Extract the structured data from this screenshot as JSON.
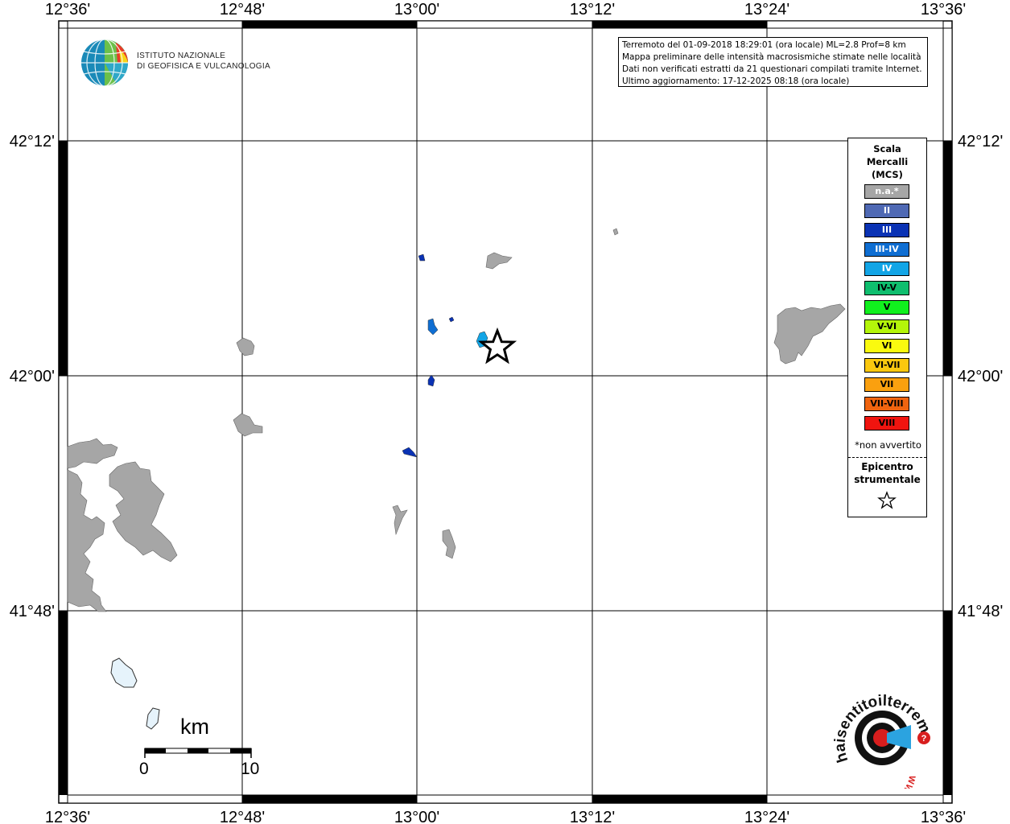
{
  "map": {
    "lon_ticks": [
      "12°36'",
      "12°48'",
      "13°00'",
      "13°12'",
      "13°24'",
      "13°36'"
    ],
    "lat_ticks": [
      "42°12'",
      "42°00'",
      "41°48'"
    ]
  },
  "info": {
    "line1": "Terremoto del 01-09-2018 18:29:01 (ora locale) ML=2.8 Prof=8 km",
    "line2": "Mappa preliminare delle intensità macrosismiche stimate nelle località",
    "line3": "Dati non verificati estratti da 21 questionari compilati tramite Internet.",
    "line4": "Ultimo aggiornamento: 17-12-2025 08:18 (ora locale)"
  },
  "legend": {
    "title1": "Scala",
    "title2": "Mercalli",
    "title3": "(MCS)",
    "items": [
      {
        "label": "n.a.*",
        "color": "#a6a6a6",
        "text_color": "#ffffff"
      },
      {
        "label": "II",
        "color": "#4f69b4",
        "text_color": "#ffffff"
      },
      {
        "label": "III",
        "color": "#0a32b4",
        "text_color": "#ffffff"
      },
      {
        "label": "III-IV",
        "color": "#0f6ed2",
        "text_color": "#ffffff"
      },
      {
        "label": "IV",
        "color": "#12a5e6",
        "text_color": "#ffffff"
      },
      {
        "label": "IV-V",
        "color": "#0fbe6e",
        "text_color": "#000000"
      },
      {
        "label": "V",
        "color": "#11f01e",
        "text_color": "#000000"
      },
      {
        "label": "V-VI",
        "color": "#b4f50a",
        "text_color": "#000000"
      },
      {
        "label": "VI",
        "color": "#fafa0f",
        "text_color": "#000000"
      },
      {
        "label": "VI-VII",
        "color": "#fac80f",
        "text_color": "#000000"
      },
      {
        "label": "VII",
        "color": "#faa00f",
        "text_color": "#000000"
      },
      {
        "label": "VII-VIII",
        "color": "#f0640f",
        "text_color": "#000000"
      },
      {
        "label": "VIII",
        "color": "#f0140f",
        "text_color": "#000000"
      }
    ],
    "note": "*non avvertito",
    "epicenter1": "Epicentro",
    "epicenter2": "strumentale"
  },
  "logo": {
    "ingv_line1": "ISTITUTO NAZIONALE",
    "ingv_line2": "DI GEOFISICA E VULCANOLOGIA",
    "hst_text": "haisentitoilterremoto.it",
    "hst_www": "WWW."
  },
  "scale": {
    "unit": "km",
    "start": "0",
    "end": "10"
  }
}
